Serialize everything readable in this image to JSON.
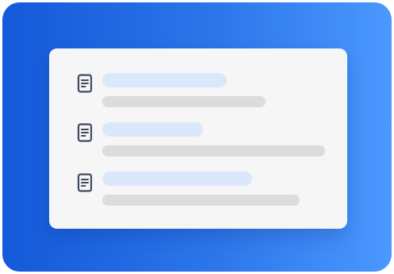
{
  "illustration": {
    "background_gradient": [
      "#1459d9",
      "#2c76ea",
      "#4b98ff"
    ],
    "card_color": "#f6f6f7",
    "icon_color": "#3d4a5c",
    "title_placeholder_color": "#dbe8fb",
    "subtitle_placeholder_color": "#dcdcde",
    "list": {
      "items": [
        {
          "icon": "document-icon",
          "title_fill": 0.5,
          "subtitle_fill": 0.65
        },
        {
          "icon": "document-icon",
          "title_fill": 0.4,
          "subtitle_fill": 0.9
        },
        {
          "icon": "document-icon",
          "title_fill": 0.6,
          "subtitle_fill": 0.79
        }
      ]
    }
  }
}
